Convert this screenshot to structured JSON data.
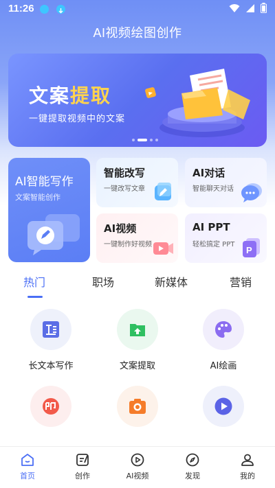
{
  "status": {
    "time": "11:26"
  },
  "app": {
    "title": "AI视频绘图创作"
  },
  "banner": {
    "title_part1": "文案",
    "title_part2": "提取",
    "subtitle": "一键提取视频中的文案"
  },
  "features": {
    "big": {
      "title": "AI智能写作",
      "subtitle": "文案智能创作"
    },
    "items": [
      {
        "title": "智能改写",
        "subtitle": "一键改写文章"
      },
      {
        "title": "AI对话",
        "subtitle": "智能聊天对话"
      },
      {
        "title": "AI视频",
        "subtitle": "一键制作好视频"
      },
      {
        "title": "AI PPT",
        "subtitle": "轻松搞定 PPT"
      }
    ]
  },
  "tabs": [
    "热门",
    "职场",
    "新媒体",
    "营销"
  ],
  "tools": [
    {
      "label": "长文本写作",
      "icon": "long-text-icon",
      "bg": "#eef1fb",
      "color": "#5b6ee6"
    },
    {
      "label": "文案提取",
      "icon": "folder-upload-icon",
      "bg": "#eaf8ef",
      "color": "#2fbf61"
    },
    {
      "label": "AI绘画",
      "icon": "palette-icon",
      "bg": "#f1eefc",
      "color": "#8b6cf0"
    },
    {
      "label": "",
      "icon": "seal-icon",
      "bg": "#fdeeee",
      "color": "#f25a4a"
    },
    {
      "label": "",
      "icon": "camera-icon",
      "bg": "#fdf2ea",
      "color": "#f57c2a"
    },
    {
      "label": "",
      "icon": "play-icon",
      "bg": "#eef0fb",
      "color": "#5b63e6"
    }
  ],
  "nav": [
    "首页",
    "创作",
    "AI视频",
    "发现",
    "我的"
  ],
  "colors": {
    "accent": "#4a6ef5",
    "brand_gradient_start": "#6f8ff5"
  }
}
